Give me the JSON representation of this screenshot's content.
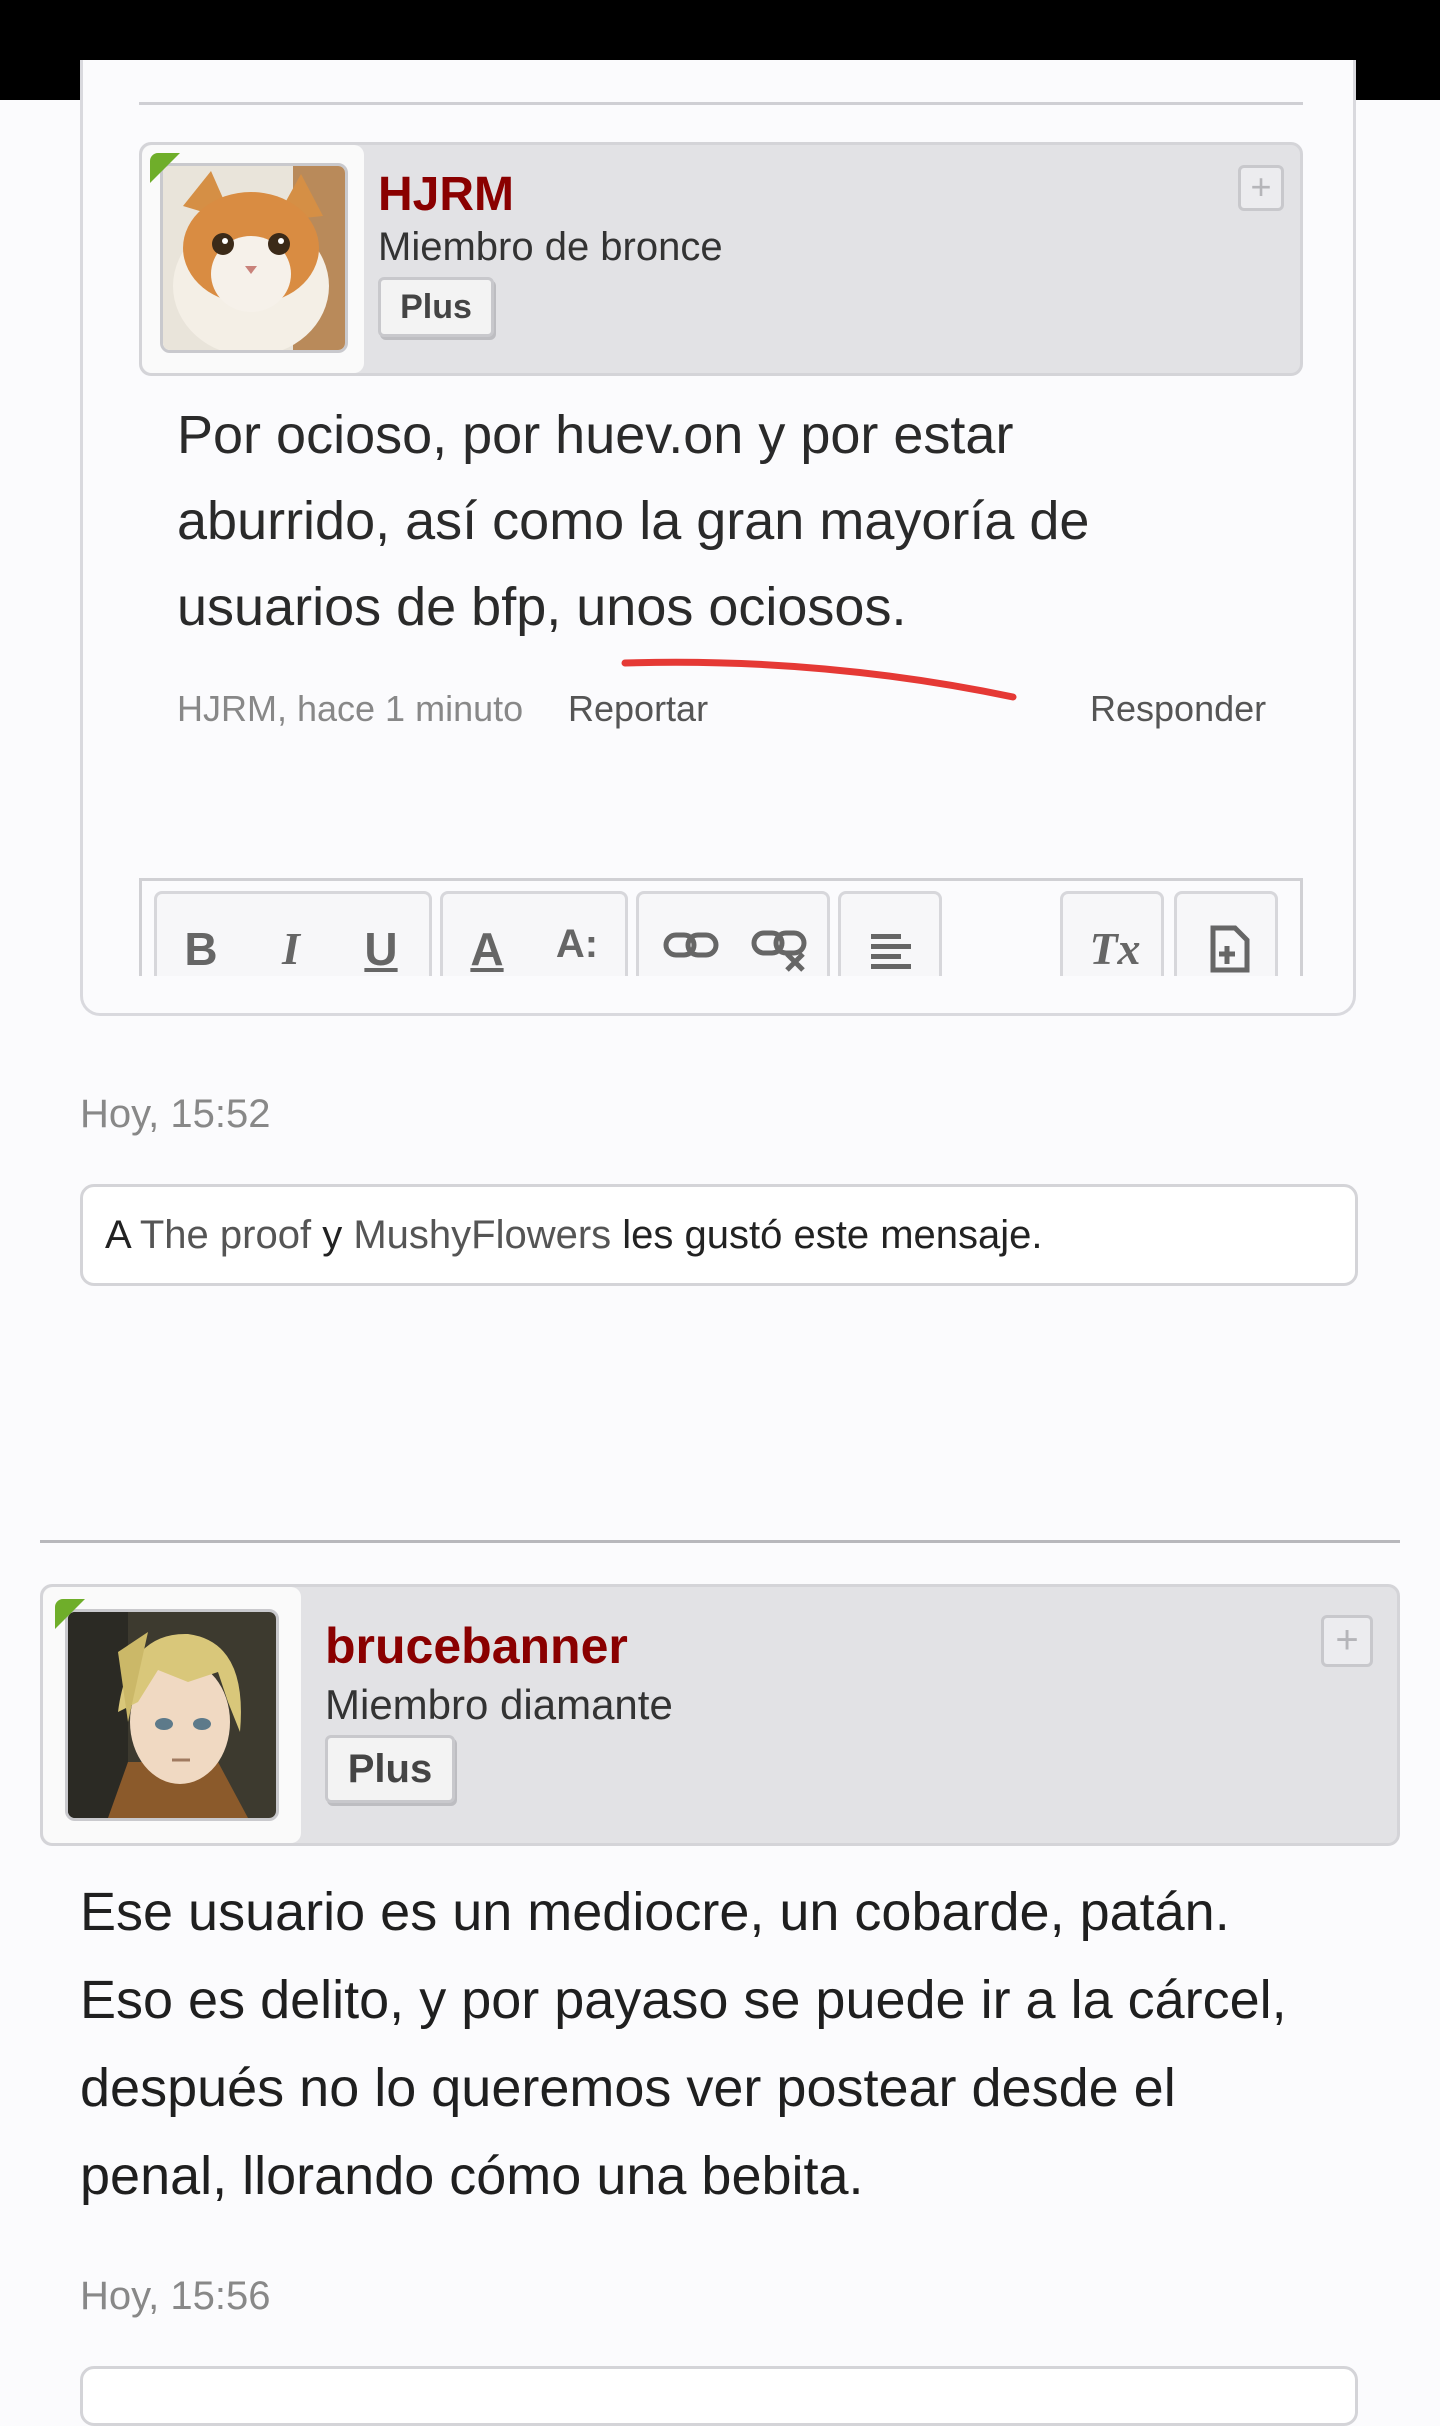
{
  "quoted_post": {
    "author": {
      "username": "HJRM",
      "rank": "Miembro de bronce",
      "badge": "Plus",
      "add_button": "+"
    },
    "lines": [
      "Por ocioso, por huev.on y por estar",
      "aburrido, así como la gran mayoría de",
      "usuarios de bfp, unos ociosos."
    ],
    "meta": "HJRM, hace 1 minuto",
    "report_label": "Reportar",
    "reply_label": "Responder",
    "toolbar": [
      "B",
      "I",
      "U",
      "A",
      "A:",
      "link",
      "unlink",
      "align",
      "Tx",
      "plugin"
    ]
  },
  "post1": {
    "timestamp": "Hoy, 15:52",
    "likes": {
      "prefix": "A ",
      "user1": "The proof",
      "joiner": " y ",
      "user2": "MushyFlowers",
      "suffix": " les gustó este mensaje."
    }
  },
  "post2": {
    "author": {
      "username": "brucebanner",
      "rank": "Miembro diamante",
      "badge": "Plus",
      "add_button": "+"
    },
    "lines": [
      "Ese usuario es un mediocre, un cobarde, patán.",
      "Eso es delito, y por payaso se puede ir a la cárcel,",
      "después no lo queremos ver postear desde el",
      "penal, llorando cómo una bebita."
    ],
    "timestamp": "Hoy, 15:56"
  },
  "colors": {
    "username": "#8a0000",
    "online": "#6fae2a",
    "annotation": "#e53935"
  }
}
